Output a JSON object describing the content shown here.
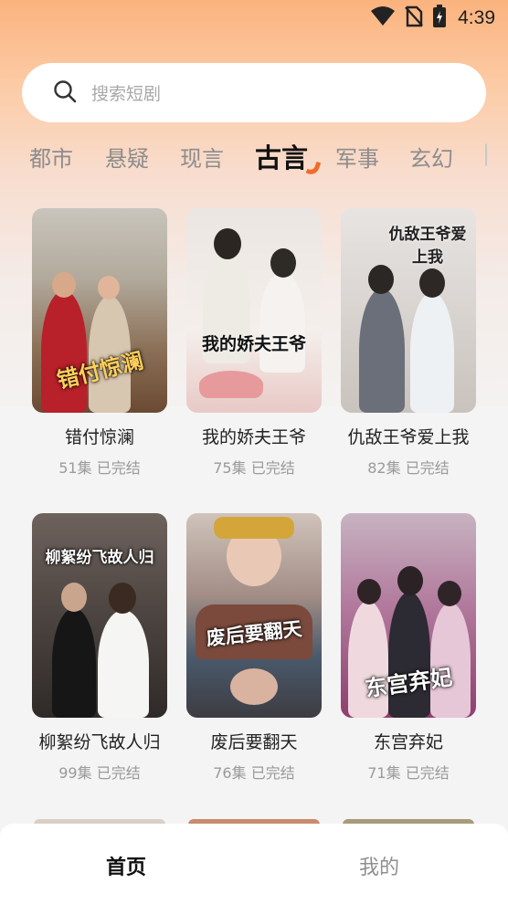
{
  "status_bar": {
    "time": "4:39",
    "icons": [
      "wifi-icon",
      "no-sim-icon",
      "battery-charging-icon"
    ]
  },
  "search": {
    "placeholder": "搜索短剧",
    "icon": "search-icon"
  },
  "tabs": [
    {
      "label": "都市",
      "active": false
    },
    {
      "label": "悬疑",
      "active": false
    },
    {
      "label": "现言",
      "active": false
    },
    {
      "label": "古言",
      "active": true
    },
    {
      "label": "军事",
      "active": false
    },
    {
      "label": "玄幻",
      "active": false
    }
  ],
  "colors": {
    "accent": "#f06a2c",
    "header_gradient_top": "#fbb37e",
    "background": "#f4f4f4"
  },
  "dramas": [
    {
      "title": "错付惊澜",
      "episodes": "51集",
      "status": "已完结",
      "poster_text": "错付惊澜"
    },
    {
      "title": "我的娇夫王爷",
      "episodes": "75集",
      "status": "已完结",
      "poster_text": "我的娇夫王爷"
    },
    {
      "title": "仇敌王爷爱上我",
      "episodes": "82集",
      "status": "已完结",
      "poster_text": "仇敌王爷爱上我"
    },
    {
      "title": "柳絮纷飞故人归",
      "episodes": "99集",
      "status": "已完结",
      "poster_text": "柳絮纷飞故人归"
    },
    {
      "title": "废后要翻天",
      "episodes": "76集",
      "status": "已完结",
      "poster_text": "废后要翻天"
    },
    {
      "title": "东宫弃妃",
      "episodes": "71集",
      "status": "已完结",
      "poster_text": "东宫弃妃"
    }
  ],
  "bottom_nav": [
    {
      "label": "首页",
      "active": true
    },
    {
      "label": "我的",
      "active": false
    }
  ]
}
